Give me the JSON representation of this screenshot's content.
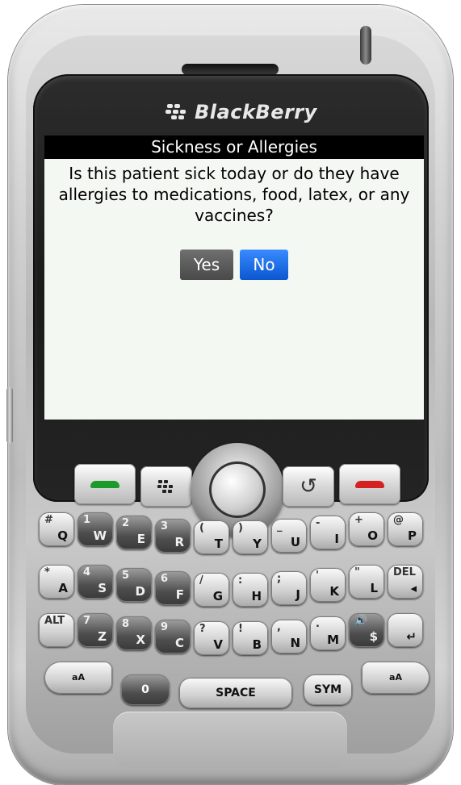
{
  "device": {
    "brand": "BlackBerry"
  },
  "dialog": {
    "title": "Sickness or Allergies",
    "question": "Is this patient sick today or do they have allergies to medications, food, latex, or any vaccines?",
    "buttons": {
      "yes": "Yes",
      "no": "No"
    },
    "selected": "No",
    "colors": {
      "title_bar": "#000000",
      "background": "#f4f8f2",
      "yes_button": "#555555",
      "no_button": "#1664e0"
    }
  },
  "nav_keys": {
    "call": "call-icon",
    "menu": "blackberry-menu-icon",
    "back": "↺",
    "end": "end-call-icon"
  },
  "keyboard": {
    "row1": [
      {
        "main": "Q",
        "alt": "#"
      },
      {
        "main": "W",
        "alt": "1"
      },
      {
        "main": "E",
        "alt": "2"
      },
      {
        "main": "R",
        "alt": "3"
      },
      {
        "main": "T",
        "alt": "("
      },
      {
        "main": "Y",
        "alt": ")"
      },
      {
        "main": "U",
        "alt": "_"
      },
      {
        "main": "I",
        "alt": "-"
      },
      {
        "main": "O",
        "alt": "+"
      },
      {
        "main": "P",
        "alt": "@"
      }
    ],
    "row2": [
      {
        "main": "A",
        "alt": "*"
      },
      {
        "main": "S",
        "alt": "4"
      },
      {
        "main": "D",
        "alt": "5"
      },
      {
        "main": "F",
        "alt": "6"
      },
      {
        "main": "G",
        "alt": "/"
      },
      {
        "main": "H",
        "alt": ":"
      },
      {
        "main": "J",
        "alt": ";"
      },
      {
        "main": "K",
        "alt": "'"
      },
      {
        "main": "L",
        "alt": "\""
      },
      {
        "main": "◂",
        "alt": "DEL"
      }
    ],
    "row3": [
      {
        "main": "",
        "alt": "ALT"
      },
      {
        "main": "Z",
        "alt": "7"
      },
      {
        "main": "X",
        "alt": "8"
      },
      {
        "main": "C",
        "alt": "9"
      },
      {
        "main": "V",
        "alt": "?"
      },
      {
        "main": "B",
        "alt": "!"
      },
      {
        "main": "N",
        "alt": ","
      },
      {
        "main": "M",
        "alt": "."
      },
      {
        "main": "$",
        "alt": "🔊"
      },
      {
        "main": "↵",
        "alt": ""
      }
    ],
    "space": "SPACE",
    "sym": "SYM",
    "zero": "0",
    "shift_left": "aA",
    "shift_right": "aA"
  }
}
